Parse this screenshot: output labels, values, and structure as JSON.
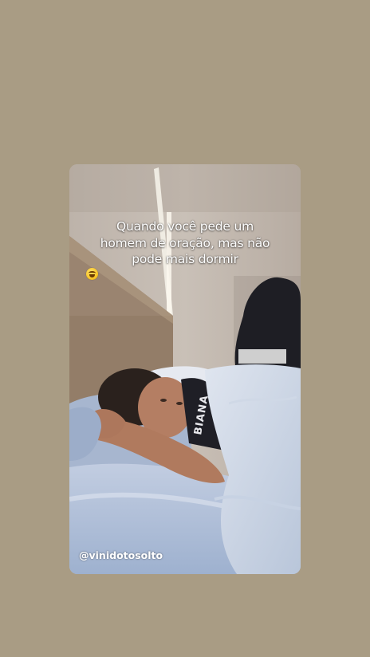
{
  "story": {
    "caption_lines": [
      "Quando você pede um",
      "homem de oração, mas não",
      "pode mais dormir"
    ],
    "caption_emoji": "rolling-on-floor-laughing-emoji",
    "watermark": "@vinidotosolto",
    "shirt_text": "BIANA"
  },
  "colors": {
    "background": "#a99c84",
    "caption_text": "#ffffff"
  }
}
